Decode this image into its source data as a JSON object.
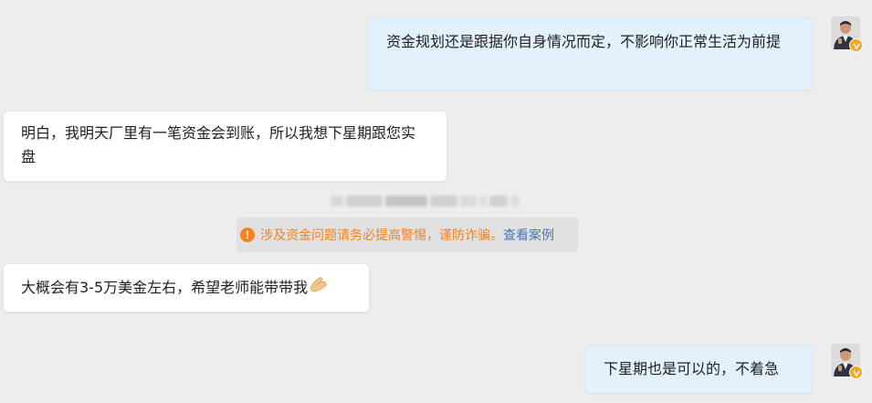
{
  "messages": [
    {
      "side": "self",
      "text": "资金规划还是跟据你自身情况而定，不影响你正常生活为前提"
    },
    {
      "side": "other",
      "text": "明白，我明天厂里有一笔资金会到账，所以我想下星期跟您实盘"
    },
    {
      "side": "other",
      "text": "大概会有3-5万美金左右，希望老师能带带我",
      "emoji": "pray-hands-icon"
    },
    {
      "side": "self",
      "text": "下星期也是可以的，不着急"
    }
  ],
  "notice": {
    "text": "涉及资金问题请务必提高警惕，谨防诈骗。",
    "link": "查看案例",
    "icon": "warning-icon",
    "color": "#f5811f",
    "link_color": "#4a73b5"
  },
  "colors": {
    "background": "#ededed",
    "self_bubble": "#e3f1fd",
    "other_bubble": "#ffffff",
    "badge": "#f5a623"
  }
}
